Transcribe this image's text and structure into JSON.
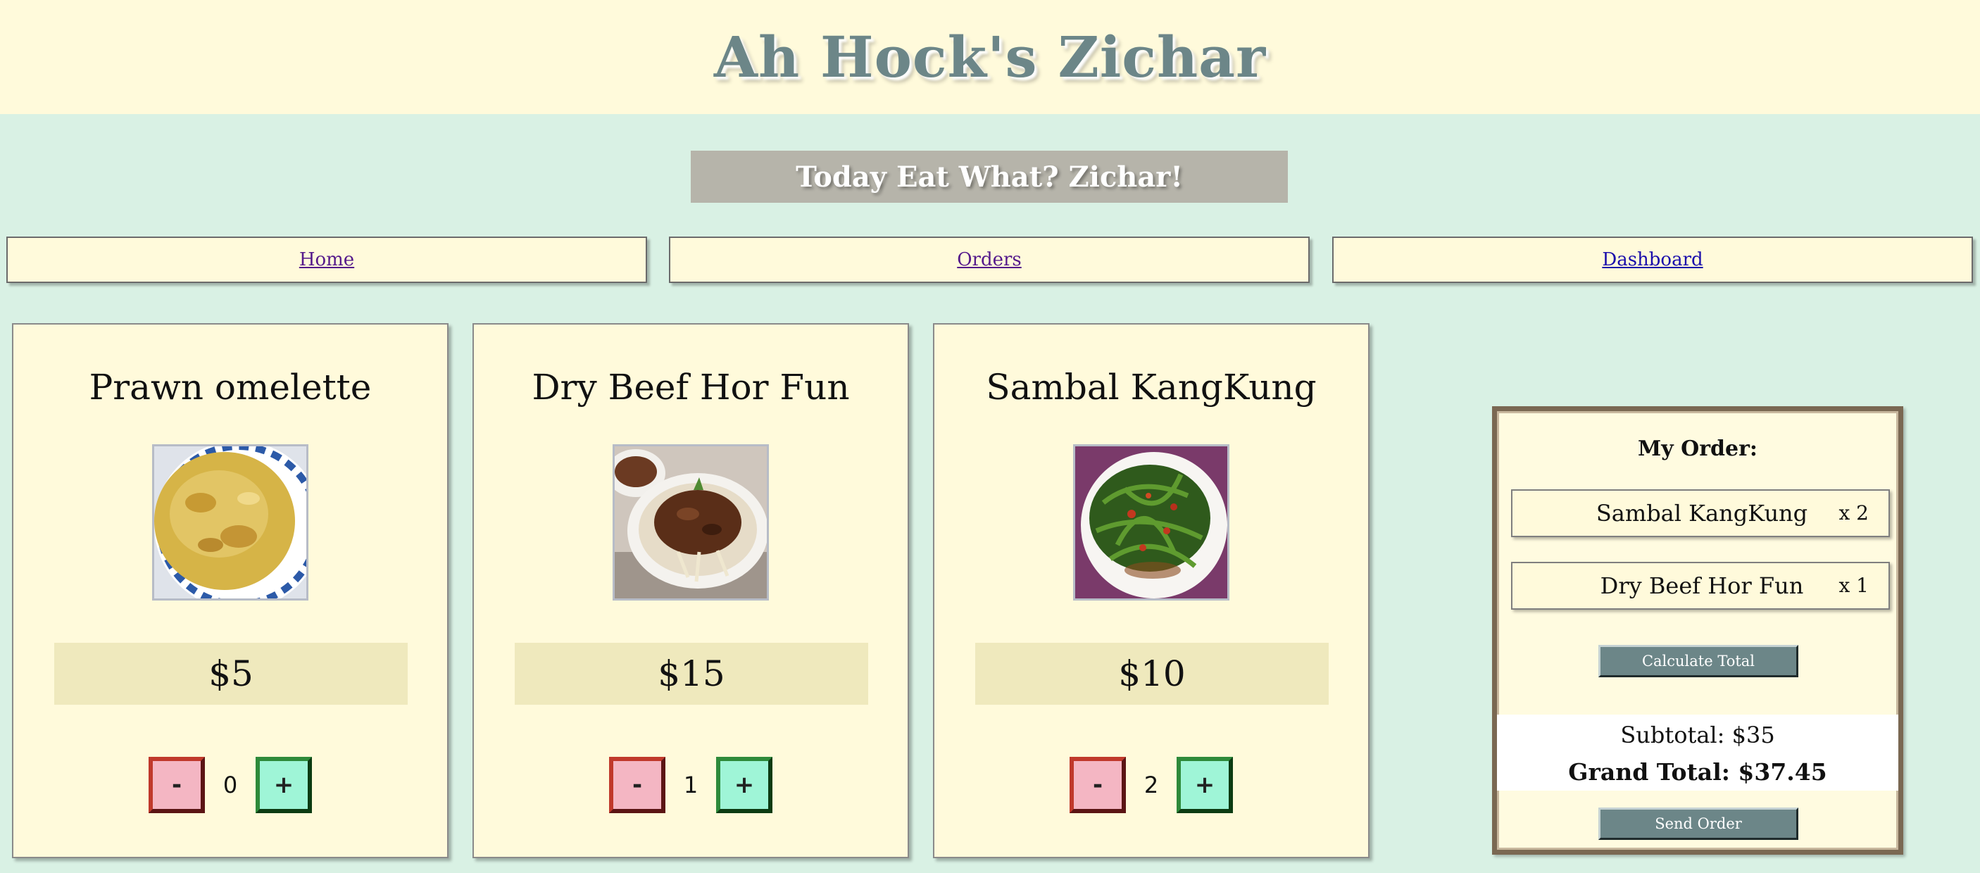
{
  "header": {
    "title": "Ah Hock's Zichar"
  },
  "banner": {
    "text": "Today Eat What? Zichar!"
  },
  "nav": [
    {
      "label": "Home",
      "visited": true
    },
    {
      "label": "Orders",
      "visited": true
    },
    {
      "label": "Dashboard",
      "visited": false
    }
  ],
  "menu": [
    {
      "name": "Prawn omelette",
      "price": "$5",
      "minus": "-",
      "plus": "+",
      "quantity": "0",
      "photo_icon": "prawn-omelette-photo"
    },
    {
      "name": "Dry Beef Hor Fun",
      "price": "$15",
      "minus": "-",
      "plus": "+",
      "quantity": "1",
      "photo_icon": "dry-beef-hor-fun-photo"
    },
    {
      "name": "Sambal KangKung",
      "price": "$10",
      "minus": "-",
      "plus": "+",
      "quantity": "2",
      "photo_icon": "sambal-kangkung-photo"
    }
  ],
  "order": {
    "heading": "My Order:",
    "items": [
      {
        "name": "Sambal KangKung",
        "qty": "x 2"
      },
      {
        "name": "Dry Beef Hor Fun",
        "qty": "x 1"
      }
    ],
    "calculate_label": "Calculate Total",
    "subtotal": "Subtotal: $35",
    "grand_total": "Grand Total: $37.45",
    "send_label": "Send Order"
  },
  "colors": {
    "page_bg": "#d9f1e4",
    "cream": "#fffadb",
    "title": "#6c8688",
    "banner": "#b6b4aa",
    "price_bg": "#efe9bd",
    "minus": "#f4b6c3",
    "plus": "#9ff5d7",
    "button": "#6c8688",
    "panel_border": "#7a6852"
  }
}
